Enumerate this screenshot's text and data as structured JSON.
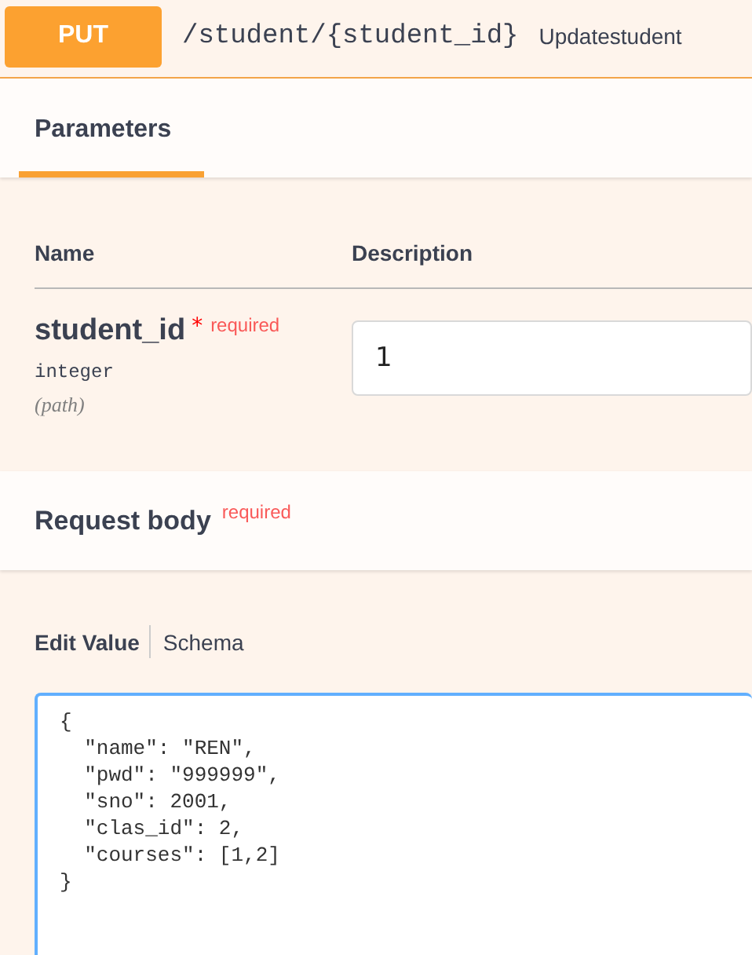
{
  "operation": {
    "method": "PUT",
    "path": "/student/{student_id}",
    "summary": "Updatestudent"
  },
  "tabs": [
    {
      "label": "Parameters",
      "selected": true
    }
  ],
  "parameters": {
    "columns": [
      "Name",
      "Description"
    ],
    "rows": [
      {
        "name": "student_id",
        "required_mark": "*",
        "required": "required",
        "type": "integer",
        "location": "(path)",
        "value": "1"
      }
    ]
  },
  "request_body": {
    "title": "Request body",
    "required": "required",
    "tabs": [
      {
        "label": "Edit Value",
        "selected": true
      },
      {
        "label": "Schema",
        "selected": false
      }
    ],
    "value": "{\n  \"name\": \"REN\",\n  \"pwd\": \"999999\",\n  \"sno\": 2001,\n  \"clas_id\": 2,\n  \"courses\": [1,2]\n}"
  }
}
